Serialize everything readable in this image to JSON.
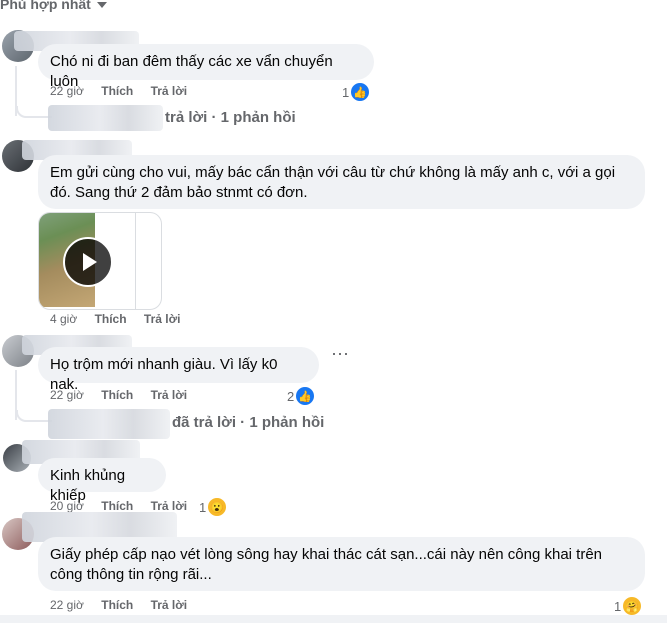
{
  "sort_label": "Phù hợp nhất",
  "actions": {
    "like": "Thích",
    "reply": "Trả lời"
  },
  "comments": [
    {
      "text": "Chó ni đi ban đêm thấy các xe vẩn chuyển luôn",
      "time": "22 giờ",
      "reactions": "1",
      "replies_note": "trả lời · 1 phản hồi"
    },
    {
      "text": "Em gửi cùng cho vui, mấy bác cẩn thận với câu từ chứ không là mấy anh c, với a gọi đó. Sang thứ 2 đảm bảo stnmt có đơn.",
      "time": "4 giờ"
    },
    {
      "text": "Họ trộm mới nhanh giàu. Vì lấy k0 nak.",
      "time": "22 giờ",
      "reactions": "2",
      "replies_note": "đã trả lời · 1 phản hồi"
    },
    {
      "text": "Kinh khủng khiếp",
      "time": "20 giờ",
      "reactions": "1"
    },
    {
      "text": "Giấy phép cấp nạo vét lòng sông hay khai thác cát sạn...cái này nên công khai trên công thông tin rộng rãi...",
      "time": "22 giờ",
      "reactions": "1"
    }
  ]
}
